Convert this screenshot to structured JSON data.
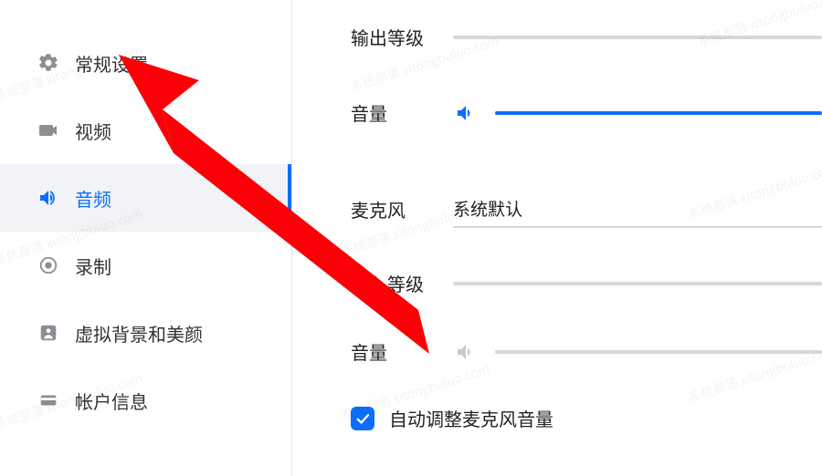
{
  "sidebar": {
    "items": [
      {
        "label": "常规设置",
        "icon": "gear-icon"
      },
      {
        "label": "视频",
        "icon": "video-icon"
      },
      {
        "label": "音频",
        "icon": "audio-icon",
        "active": true
      },
      {
        "label": "录制",
        "icon": "record-icon"
      },
      {
        "label": "虚拟背景和美颜",
        "icon": "person-icon"
      },
      {
        "label": "帐户信息",
        "icon": "card-icon"
      }
    ]
  },
  "audio": {
    "output_level_label": "输出等级",
    "output_volume_label": "音量",
    "output_volume_percent": 100,
    "mic_label": "麦克风",
    "mic_value": "系统默认",
    "input_level_label": "输入等级",
    "input_volume_label": "音量",
    "auto_adjust_label": "自动调整麦克风音量",
    "auto_adjust_checked": true
  },
  "watermark": "系统部落 xitongbuluo.com",
  "colors": {
    "accent": "#0d6efd",
    "arrow": "#fb0007"
  }
}
